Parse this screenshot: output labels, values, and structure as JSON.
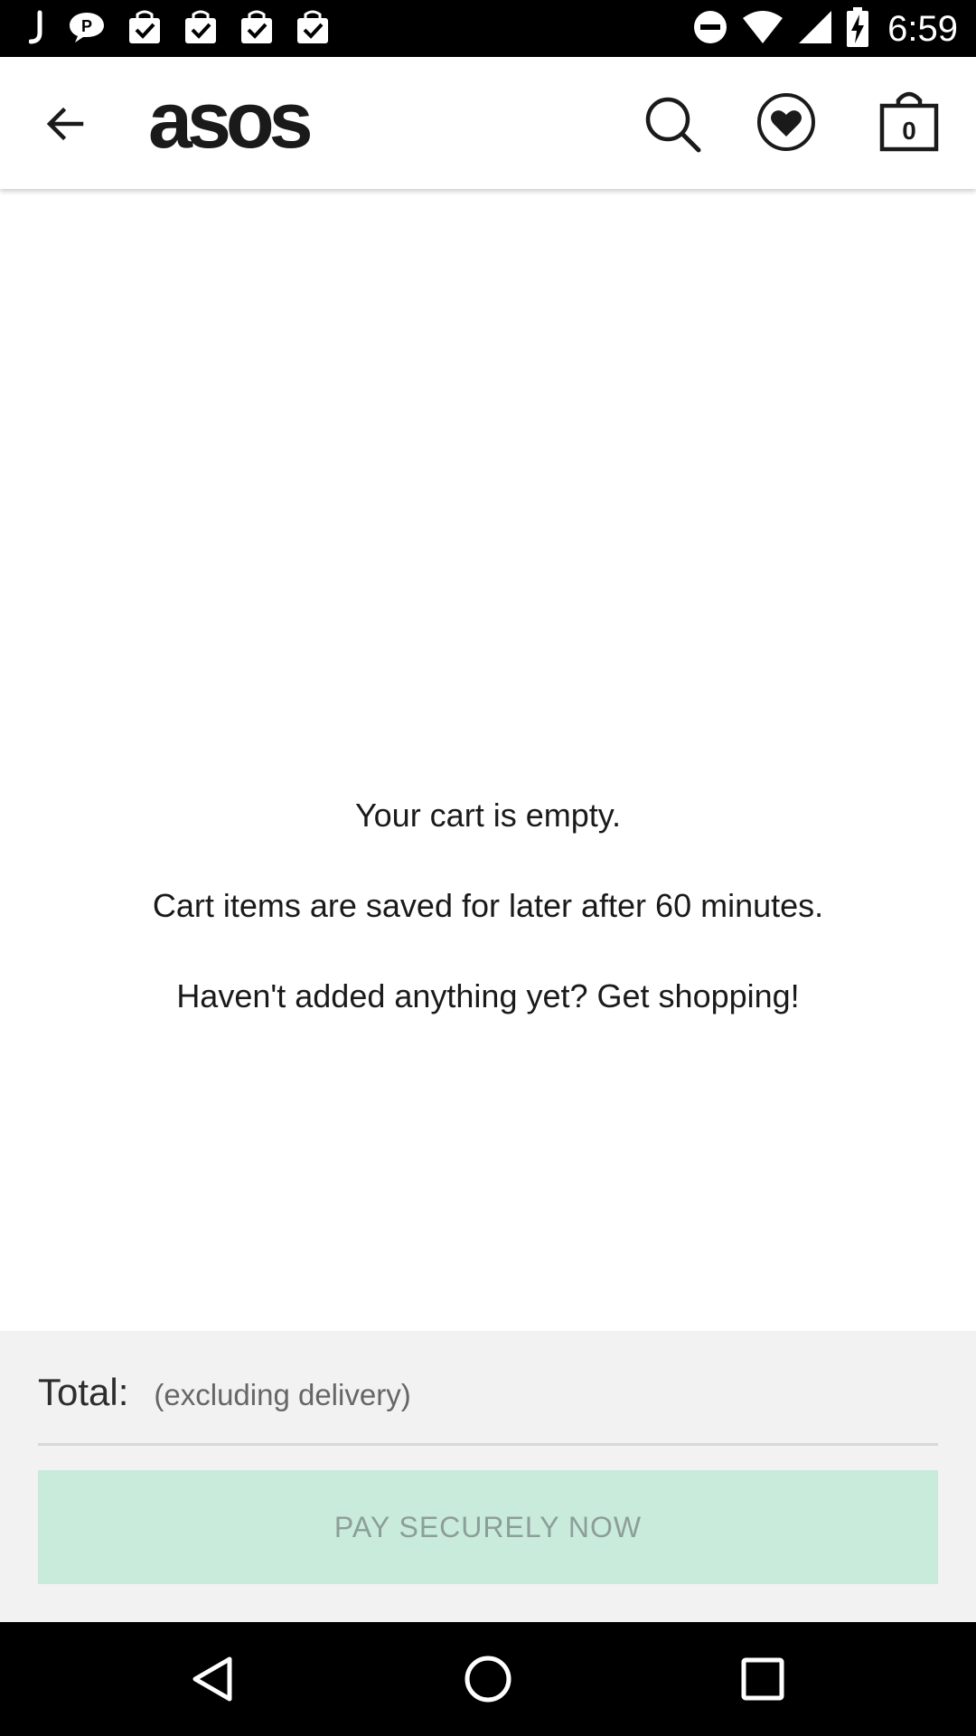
{
  "status_bar": {
    "time": "6:59",
    "notification_icons": [
      "j-app-icon",
      "chat-bubble-icon",
      "bag-check-icon",
      "bag-check-icon",
      "bag-check-icon",
      "bag-check-icon"
    ],
    "system_icons": [
      "do-not-disturb-icon",
      "wifi-icon",
      "signal-icon",
      "battery-charging-icon"
    ]
  },
  "app_bar": {
    "logo": "asos",
    "bag_count": "0"
  },
  "cart": {
    "empty_title": "Your cart is empty.",
    "saved_note": "Cart items are saved for later after 60 minutes.",
    "prompt": "Haven't added anything yet? Get shopping!"
  },
  "summary": {
    "total_label": "Total:",
    "total_note": "(excluding delivery)",
    "pay_button": "PAY SECURELY NOW"
  },
  "colors": {
    "pay_button_bg": "#c8ebdc",
    "pay_button_text": "#8d9e98",
    "summary_bg": "#f2f2f2"
  }
}
